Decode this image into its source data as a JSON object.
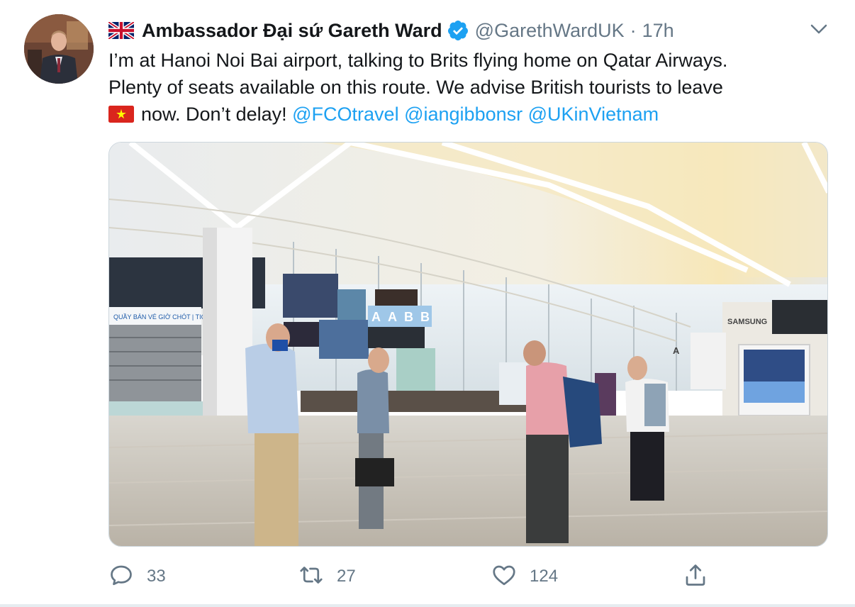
{
  "author": {
    "display_name": "Ambassador Đại sứ Gareth Ward",
    "handle": "@GarethWardUK",
    "separator": "·",
    "time": "17h",
    "verified": true
  },
  "tweet": {
    "text_line1": "I’m at Hanoi Noi Bai airport, talking to Brits flying home on Qatar Airways.",
    "text_line2": "Plenty of seats available on this route. We advise British tourists to leave",
    "text_line3_pre": "now. Don’t delay!",
    "mentions": [
      "@FCOtravel",
      "@iangibbonsr",
      "@UKinVietnam"
    ]
  },
  "media": {
    "signs": {
      "ticket_office": "QUẦY BÁN VÉ GIỜ CHÓT | TICKET OFFICE",
      "samsung": "SAMSUNG",
      "zone_letters": [
        "A",
        "A",
        "B",
        "B"
      ],
      "zone_a": "A"
    }
  },
  "actions": {
    "reply_count": "33",
    "retweet_count": "27",
    "like_count": "124"
  },
  "colors": {
    "link": "#1da1f2",
    "secondary_text": "#657786",
    "verified": "#1da1f2"
  },
  "icons": {
    "menu": "chevron-down-icon",
    "verified": "verified-badge-icon",
    "reply": "reply-icon",
    "retweet": "retweet-icon",
    "like": "heart-icon",
    "share": "share-icon",
    "uk_flag": "uk-flag-icon",
    "vn_flag": "vietnam-flag-icon"
  }
}
